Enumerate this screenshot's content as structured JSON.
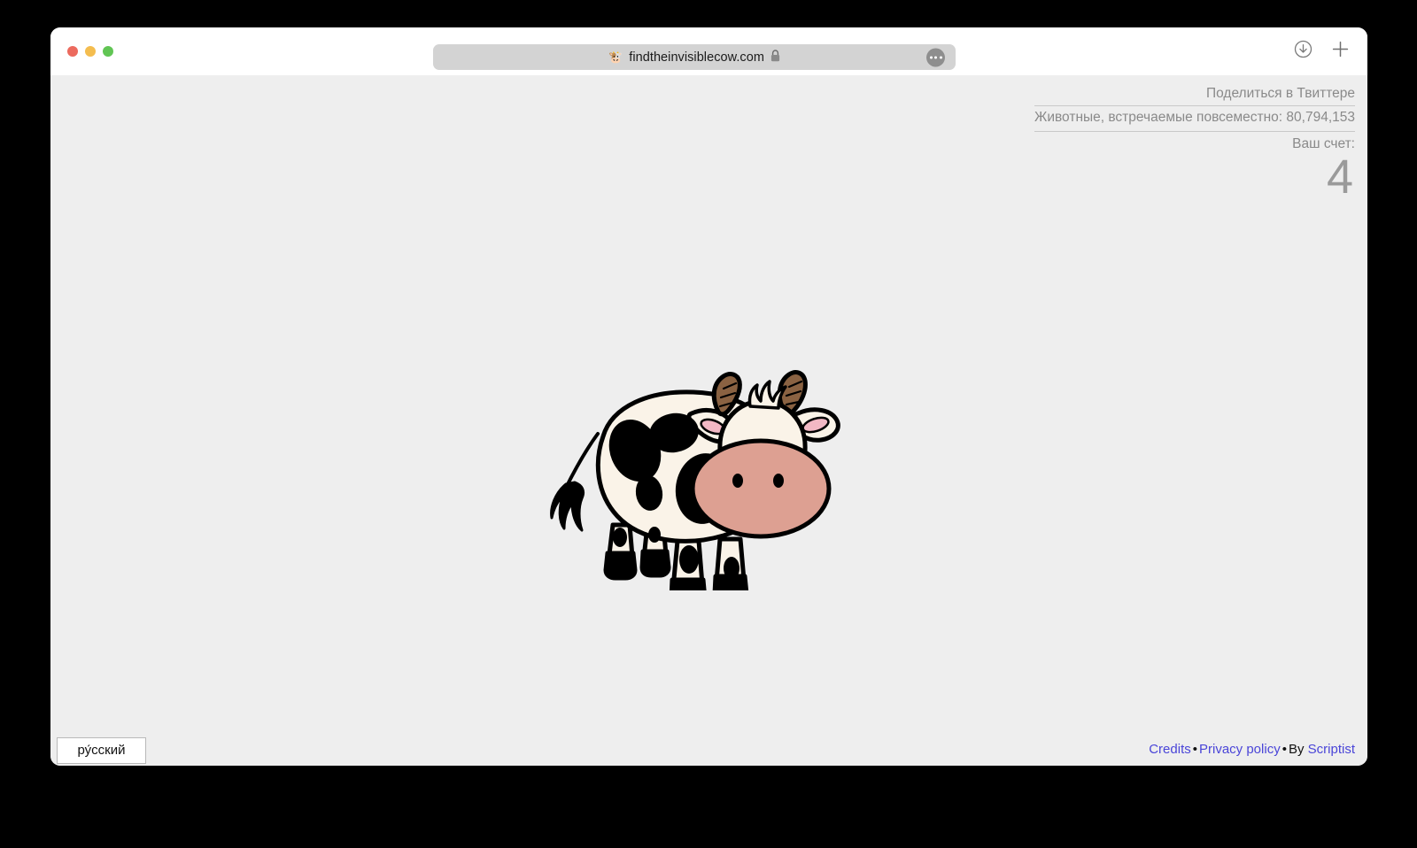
{
  "window": {
    "traffic_lights": [
      {
        "name": "close",
        "color": "#ec6a5e"
      },
      {
        "name": "minimize",
        "color": "#f4bd4f"
      },
      {
        "name": "maximize",
        "color": "#61c554"
      }
    ],
    "address_bar": {
      "favicon": "cow-favicon",
      "url": "findtheinvisiblecow.com",
      "lock_icon": "lock-icon",
      "menu_icon": "ellipsis-icon"
    },
    "toolbar_right": [
      {
        "name": "downloads-icon",
        "label": "download-circle-icon"
      },
      {
        "name": "new-tab-icon",
        "label": "plus-icon"
      }
    ]
  },
  "page": {
    "background_color": "#eeeeee",
    "stats": {
      "share_twitter": "Поделиться в Твиттере",
      "animals_found_label": "Животные, встречаемые повсеместно: 80,794,153",
      "score_label": "Ваш счет:",
      "score_value": "4"
    },
    "cow": {
      "name": "cow-illustration",
      "colors": {
        "body": "#faf3e8",
        "spots": "#000000",
        "outline": "#000000",
        "muzzle": "#dda092",
        "horn": "#8a6242",
        "ear_inner": "#f6bfca"
      }
    },
    "language_button": "ру́сский",
    "footer": {
      "credits": "Credits",
      "separator": "•",
      "privacy_policy": "Privacy policy",
      "by_label": "By",
      "author": "Scriptist",
      "link_color": "#4a45d8"
    }
  }
}
